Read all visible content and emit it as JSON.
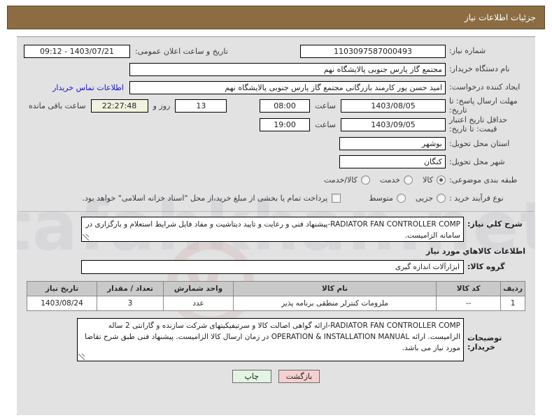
{
  "header": {
    "title": "جزئیات اطلاعات نیاز"
  },
  "watermark": {
    "text": "tafahkhan.net",
    "mark": "V"
  },
  "form": {
    "need_number": {
      "label": "شماره نیاز:",
      "value": "1103097587000493"
    },
    "public_announce": {
      "label": "تاریخ و ساعت اعلان عمومی:",
      "value": "1403/07/21 - 09:12"
    },
    "buyer_org": {
      "label": "نام دستگاه خریدار:",
      "value": "مجتمع گاز پارس جنوبی  پالایشگاه نهم"
    },
    "request_creator": {
      "label": "ایجاد کننده درخواست:",
      "value": "امید حسن پور کارمند بازرگانی مجتمع گاز پارس جنوبی  پالایشگاه نهم"
    },
    "buyer_contact_link": "اطلاعات تماس خریدار",
    "response_deadline": {
      "label": "مهلت ارسال پاسخ: تا تاریخ:",
      "date": "1403/08/05",
      "time_label": "ساعت",
      "time": "08:00",
      "days": "13",
      "days_label": "روز و",
      "countdown": "22:27:48",
      "remaining_label": "ساعت باقی مانده"
    },
    "price_validity": {
      "label": "حداقل تاریخ اعتبار قیمت: تا تاریخ:",
      "date": "1403/09/05",
      "time_label": "ساعت",
      "time": "19:00"
    },
    "delivery_province": {
      "label": "استان محل تحویل:",
      "value": "بوشهر"
    },
    "delivery_city": {
      "label": "شهر محل تحویل:",
      "value": "کنگان"
    },
    "subject_category": {
      "label": "طبقه بندی موضوعی:",
      "options": [
        "کالا",
        "خدمت",
        "کالا/خدمت"
      ],
      "selected_index": 0
    },
    "purchase_process": {
      "label": "نوع فرآیند خرید :",
      "options": [
        "جزیی",
        "متوسط"
      ],
      "selected_index": -1
    },
    "treasury_checkbox": {
      "checked": false,
      "label": "پرداخت تمام یا بخشی از مبلغ خرید،از محل \"اسناد خزانه اسلامی\" خواهد بود."
    }
  },
  "description": {
    "label": "شرح كلي نياز:",
    "english_part": "RADIATOR FAN CONTROLLER COMP",
    "text": "-پیشنهاد فنی و رعایت و تایید دیتاشیت و مفاد فایل شرایط استعلام و بارگزاری در سامانه الزامیست."
  },
  "goods_section": {
    "title": "اطلاعات كالاهاي مورد نياز",
    "group": {
      "label": "گروه كالا:",
      "value": "ابزارآلات اندازه گیری"
    },
    "table": {
      "columns": [
        "ردیف",
        "کد کالا",
        "نام کالا",
        "واحد شمارش",
        "تعداد / مقدار",
        "تاریخ نیاز"
      ],
      "rows": [
        {
          "row_no": "1",
          "code": "--",
          "name": "ملزومات کنترلر منطقی برنامه پذیر",
          "unit": "عدد",
          "qty": "3",
          "need_date": "1403/08/24"
        }
      ]
    }
  },
  "buyer_notes": {
    "label": "توضیحات خریدار:",
    "english_part_1": "RADIATOR FAN CONTROLLER COMP",
    "text_1": "-ارائه گواهی اصالت کالا و سرتیفیکیتهای شرکت سازنده و گارانتی 2 ساله الزامیست. ارائه",
    "english_part_2": "OPERATION  & INSTALLATION MANUAL",
    "text_2": "در زمان ارسال کالا الزامیست. پیشنهاد فنی طبق شرح تقاضا مورد نیاز می باشد."
  },
  "buttons": {
    "print": "چاپ",
    "back": "بازگشت"
  },
  "colors": {
    "header_bg": "#8c6d43",
    "panel_bg": "#e2e2e2",
    "link": "#1414d0",
    "table_header_bg": "#c9c9c9",
    "btn_back_bg": "#f6d0d0",
    "btn_print_bg": "#e2f4e2",
    "countdown_bg": "#f2f2e0"
  }
}
